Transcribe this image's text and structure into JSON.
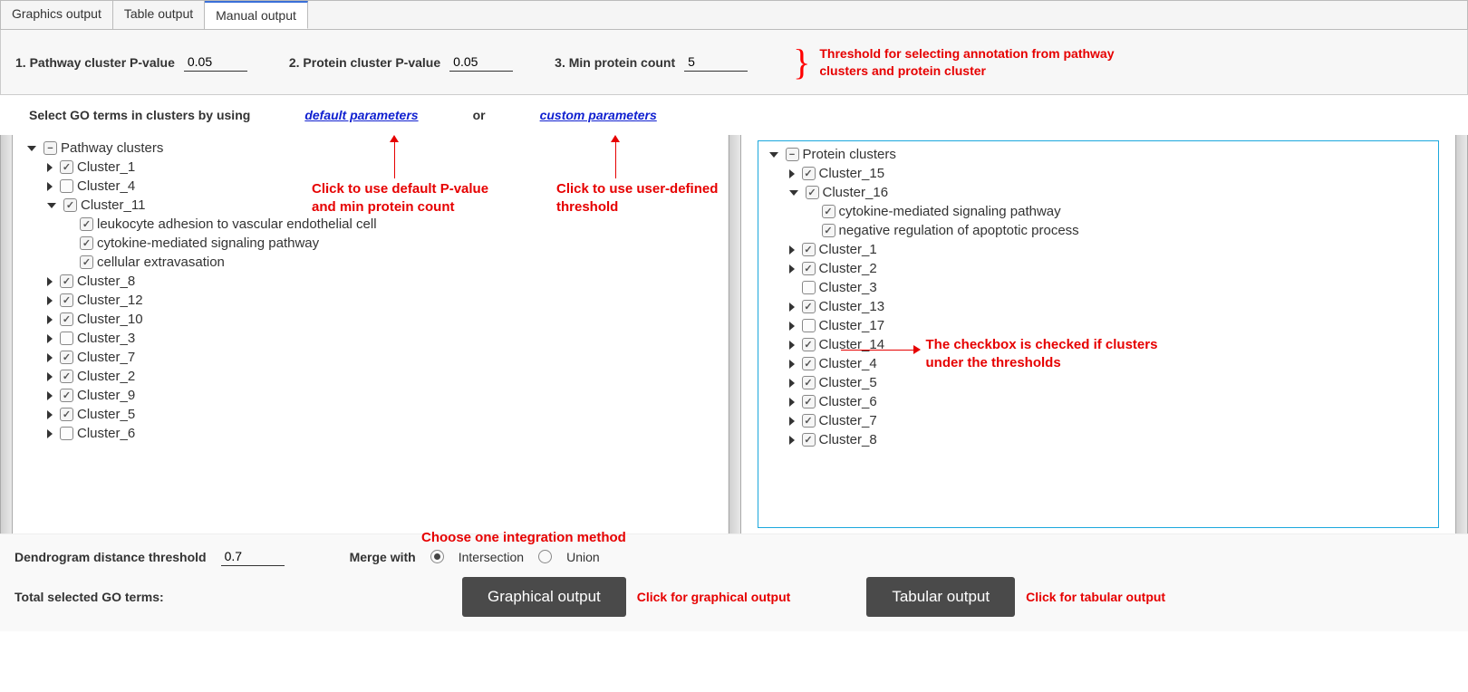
{
  "tabs": {
    "graphics": "Graphics output",
    "table": "Table output",
    "manual": "Manual output"
  },
  "params": {
    "p1_label": "1.  Pathway cluster P-value",
    "p1_value": "0.05",
    "p2_label": "2.  Protein cluster P-value",
    "p2_value": "0.05",
    "p3_label": "3.  Min protein count",
    "p3_value": "5"
  },
  "annotations": {
    "threshold": "Threshold for selecting annotation from pathway clusters and protein cluster",
    "default_click": "Click to use default P-value and min protein count",
    "custom_click": "Click to use user-defined threshold",
    "checkbox_note": "The checkbox is checked if clusters under the thresholds",
    "integration": "Choose one integration method",
    "graph_click": "Click for graphical output",
    "table_click": "Click for tabular output"
  },
  "select_row": {
    "prefix": "Select GO terms in clusters by using",
    "default": "default parameters",
    "or": "or",
    "custom": "custom parameters"
  },
  "left_tree": {
    "root": "Pathway clusters",
    "nodes": [
      {
        "label": "Cluster_1",
        "checked": true,
        "caret": "right"
      },
      {
        "label": "Cluster_4",
        "checked": false,
        "caret": "right"
      },
      {
        "label": "Cluster_11",
        "checked": true,
        "caret": "down",
        "children": [
          {
            "label": "leukocyte adhesion to vascular endothelial cell",
            "checked": true
          },
          {
            "label": "cytokine-mediated signaling pathway",
            "checked": true
          },
          {
            "label": "cellular extravasation",
            "checked": true
          }
        ]
      },
      {
        "label": "Cluster_8",
        "checked": true,
        "caret": "right"
      },
      {
        "label": "Cluster_12",
        "checked": true,
        "caret": "right"
      },
      {
        "label": "Cluster_10",
        "checked": true,
        "caret": "right"
      },
      {
        "label": "Cluster_3",
        "checked": false,
        "caret": "right"
      },
      {
        "label": "Cluster_7",
        "checked": true,
        "caret": "right"
      },
      {
        "label": "Cluster_2",
        "checked": true,
        "caret": "right"
      },
      {
        "label": "Cluster_9",
        "checked": true,
        "caret": "right"
      },
      {
        "label": "Cluster_5",
        "checked": true,
        "caret": "right"
      },
      {
        "label": "Cluster_6",
        "checked": false,
        "caret": "right"
      }
    ]
  },
  "right_tree": {
    "root": "Protein clusters",
    "nodes": [
      {
        "label": "Cluster_15",
        "checked": true,
        "caret": "right"
      },
      {
        "label": "Cluster_16",
        "checked": true,
        "caret": "down",
        "children": [
          {
            "label": "cytokine-mediated signaling pathway",
            "checked": true
          },
          {
            "label": "negative regulation of apoptotic process",
            "checked": true
          }
        ]
      },
      {
        "label": "Cluster_1",
        "checked": true,
        "caret": "right"
      },
      {
        "label": "Cluster_2",
        "checked": true,
        "caret": "right"
      },
      {
        "label": "Cluster_3",
        "checked": false,
        "caret": "none"
      },
      {
        "label": "Cluster_13",
        "checked": true,
        "caret": "right"
      },
      {
        "label": "Cluster_17",
        "checked": false,
        "caret": "right"
      },
      {
        "label": "Cluster_14",
        "checked": true,
        "caret": "right"
      },
      {
        "label": "Cluster_4",
        "checked": true,
        "caret": "right"
      },
      {
        "label": "Cluster_5",
        "checked": true,
        "caret": "right"
      },
      {
        "label": "Cluster_6",
        "checked": true,
        "caret": "right"
      },
      {
        "label": "Cluster_7",
        "checked": true,
        "caret": "right"
      },
      {
        "label": "Cluster_8",
        "checked": true,
        "caret": "right"
      }
    ]
  },
  "bottom": {
    "dist_label": "Dendrogram distance threshold",
    "dist_value": "0.7",
    "merge_label": "Merge with",
    "intersection": "Intersection",
    "union": "Union",
    "total_label": "Total selected GO terms:",
    "graphical_btn": "Graphical output",
    "tabular_btn": "Tabular output"
  }
}
